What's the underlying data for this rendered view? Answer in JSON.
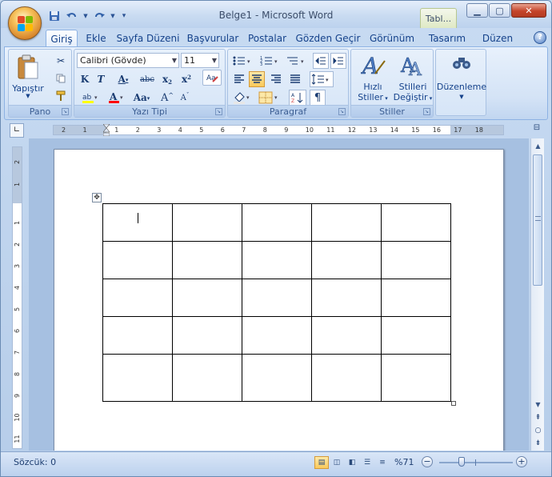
{
  "window": {
    "title": "Belge1 - Microsoft Word",
    "context_tab": "Tabl..."
  },
  "qat": {
    "save_icon": "save-icon",
    "undo_icon": "undo-icon",
    "redo_icon": "redo-icon"
  },
  "tabs": [
    {
      "label": "Giriş",
      "active": true
    },
    {
      "label": "Ekle"
    },
    {
      "label": "Sayfa Düzeni"
    },
    {
      "label": "Başvurular"
    },
    {
      "label": "Postalar"
    },
    {
      "label": "Gözden Geçir"
    },
    {
      "label": "Görünüm"
    },
    {
      "label": "Tasarım"
    },
    {
      "label": "Düzen"
    }
  ],
  "ribbon": {
    "clipboard": {
      "label": "Pano",
      "paste": "Yapıştır"
    },
    "font": {
      "label": "Yazı Tipi",
      "font_name": "Calibri (Gövde)",
      "font_size": "11"
    },
    "paragraph": {
      "label": "Paragraf"
    },
    "styles": {
      "label": "Stiller",
      "quick_styles_1": "Hızlı",
      "quick_styles_2": "Stiller",
      "change_styles_1": "Stilleri",
      "change_styles_2": "Değiştir"
    },
    "editing": {
      "label": "Düzenleme"
    }
  },
  "hruler_numbers": [
    "2",
    "1",
    "1",
    "2",
    "3",
    "4",
    "5",
    "6",
    "7",
    "8",
    "9",
    "10",
    "11",
    "12",
    "13",
    "14",
    "15",
    "16",
    "17",
    "18"
  ],
  "vruler_numbers": [
    "2",
    "1",
    "1",
    "2",
    "3",
    "4",
    "5",
    "6",
    "7",
    "8",
    "9",
    "10",
    "11"
  ],
  "status": {
    "words": "Sözcük: 0",
    "zoom": "%71",
    "zoom_fraction": 0.3
  },
  "colors": {
    "highlight": "#ffff00",
    "font_color": "#ff0000",
    "accent": "#15428b"
  }
}
